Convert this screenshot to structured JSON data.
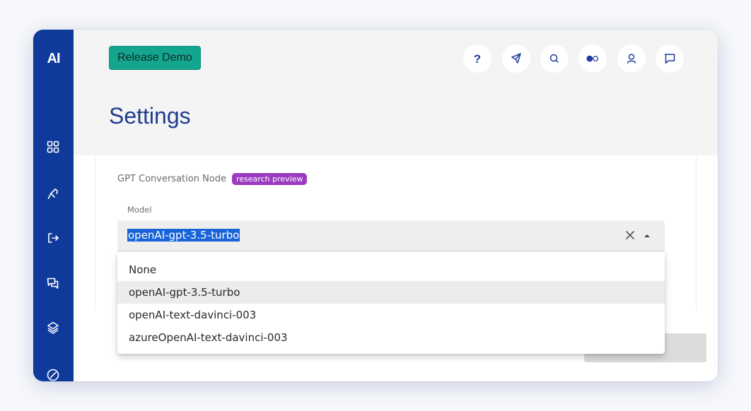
{
  "app": {
    "logo": "AI"
  },
  "sidebar": {
    "icons": [
      "grid-icon",
      "pin-icon",
      "logout-icon",
      "chat-bubbles-icon",
      "layers-icon",
      "pie-chart-icon"
    ]
  },
  "header": {
    "release_button": "Release Demo",
    "actions": [
      "help-icon",
      "compass-icon",
      "search-icon",
      "toggle-icon",
      "user-icon",
      "chat-icon"
    ]
  },
  "page": {
    "title": "Settings"
  },
  "settings": {
    "node_label": "GPT Conversation Node",
    "badge": "research preview",
    "model_label": "Model",
    "model_value": "openAI-gpt-3.5-turbo",
    "options": [
      "None",
      "openAI-gpt-3.5-turbo",
      "openAI-text-davinci-003",
      "azureOpenAI-text-davinci-003"
    ],
    "selected_index": 1
  },
  "colors": {
    "sidebar": "#0f3a9b",
    "accent_button": "#14a58e",
    "badge": "#9b3cc0",
    "title": "#1f3c8f",
    "selection": "#1a63d8"
  }
}
